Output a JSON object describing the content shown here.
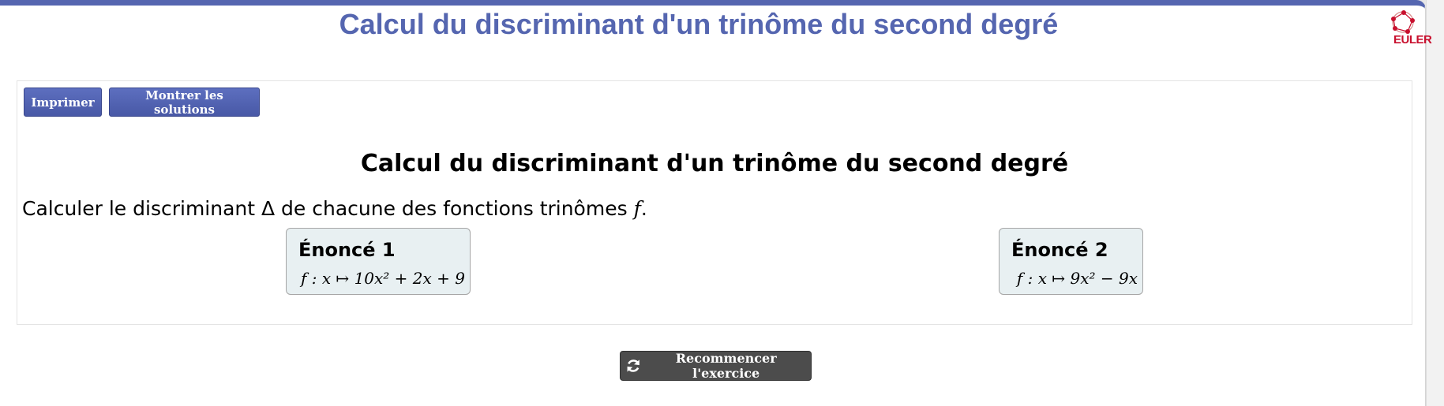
{
  "header": {
    "title": "Calcul du discriminant d'un trinôme du second degré",
    "logo_text": "EULER",
    "logo_icon": "euler-graph-icon"
  },
  "toolbar": {
    "print_label": "Imprimer",
    "solutions_label": "Montrer les solutions"
  },
  "exercise": {
    "title": "Calcul du discriminant d'un trinôme du second degré",
    "instruction_before": "Calculer le discriminant Δ de chacune des fonctions trinômes ",
    "instruction_var": "f",
    "instruction_after": ".",
    "statements": [
      {
        "label": "Énoncé 1",
        "formula": "f : x ↦ 10x² + 2x + 9"
      },
      {
        "label": "Énoncé 2",
        "formula": "f : x ↦ 9x² − 9x"
      }
    ]
  },
  "footer": {
    "restart_label": "Recommencer l'exercice",
    "restart_icon": "refresh-icon"
  },
  "colors": {
    "accent": "#5566b0",
    "logo": "#c8102e",
    "card_bg": "#e8f0f2",
    "restart_bg": "#4c4c4c"
  }
}
